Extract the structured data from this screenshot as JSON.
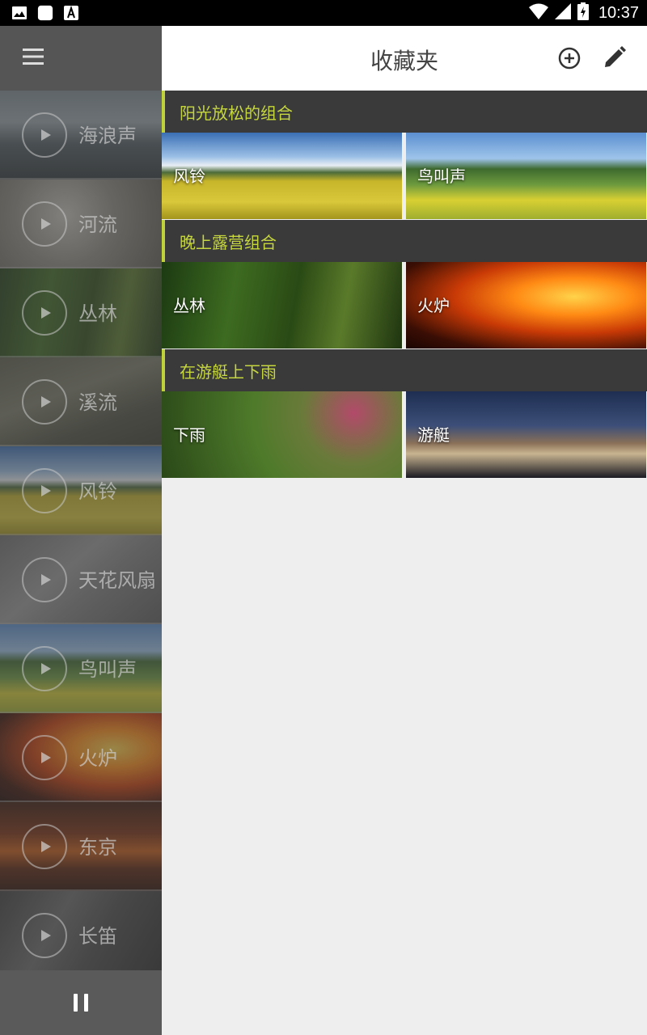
{
  "status_bar": {
    "time": "10:37",
    "icons": [
      "image-icon",
      "app-icon",
      "a-icon",
      "wifi-icon",
      "signal-icon",
      "battery-charging-icon"
    ]
  },
  "sidebar": {
    "menu_icon": "menu-icon",
    "sounds": [
      {
        "label": "海浪声",
        "theme": "waves"
      },
      {
        "label": "河流",
        "theme": "river"
      },
      {
        "label": "丛林",
        "theme": "jungle"
      },
      {
        "label": "溪流",
        "theme": "stream"
      },
      {
        "label": "风铃",
        "theme": "windchime"
      },
      {
        "label": "天花风扇",
        "theme": "fan"
      },
      {
        "label": "鸟叫声",
        "theme": "birds"
      },
      {
        "label": "火炉",
        "theme": "fire"
      },
      {
        "label": "东京",
        "theme": "tokyo"
      },
      {
        "label": "长笛",
        "theme": "flute"
      }
    ],
    "pause_icon": "pause-icon"
  },
  "topbar": {
    "title": "收藏夹",
    "add_icon": "add-circle-icon",
    "edit_icon": "pencil-icon"
  },
  "groups": [
    {
      "title": "阳光放松的组合",
      "tiles": [
        {
          "label": "风铃",
          "theme": "windchime"
        },
        {
          "label": "鸟叫声",
          "theme": "birds"
        }
      ]
    },
    {
      "title": "晚上露营组合",
      "tiles": [
        {
          "label": "丛林",
          "theme": "jungle"
        },
        {
          "label": "火炉",
          "theme": "fire"
        }
      ]
    },
    {
      "title": "在游艇上下雨",
      "tiles": [
        {
          "label": "下雨",
          "theme": "rain"
        },
        {
          "label": "游艇",
          "theme": "yacht"
        }
      ]
    }
  ],
  "colors": {
    "accent": "#c6d63f",
    "group_header_bg": "#3a3a3a",
    "main_bg": "#eeeeee",
    "sidebar_bg": "#4a4a4a"
  }
}
